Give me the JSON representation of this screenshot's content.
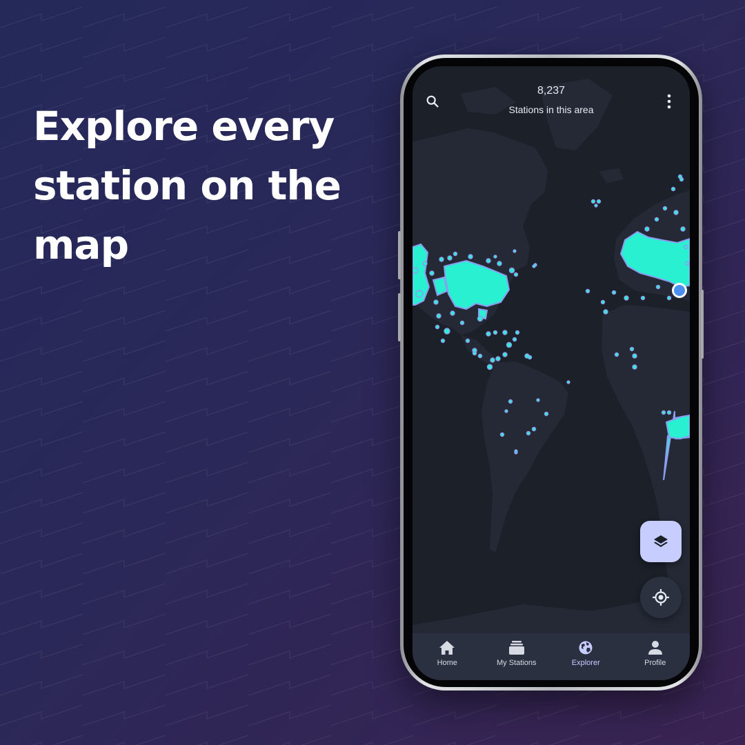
{
  "headline": "Explore every station on the map",
  "app": {
    "header": {
      "station_count": "8,237",
      "station_count_label": "Stations in this area",
      "search_icon": "search-icon",
      "menu_icon": "more-vertical-icon"
    },
    "map": {
      "land_color": "#242935",
      "sea_color": "#1b2029",
      "station_color": "#2af0d2",
      "station_outline_color": "#8c9cf0",
      "user_location_color": "#4a90f0"
    },
    "fabs": {
      "layers_icon": "layers-icon",
      "locate_icon": "my-location-icon"
    },
    "nav": [
      {
        "label": "Home",
        "icon": "home-icon"
      },
      {
        "label": "My Stations",
        "icon": "stations-icon"
      },
      {
        "label": "Explorer",
        "icon": "globe-icon"
      },
      {
        "label": "Profile",
        "icon": "person-icon"
      }
    ],
    "active_nav": "Explorer"
  },
  "colors": {
    "accent": "#c8cdff",
    "background_start": "#24295a",
    "background_end": "#3a2352"
  }
}
